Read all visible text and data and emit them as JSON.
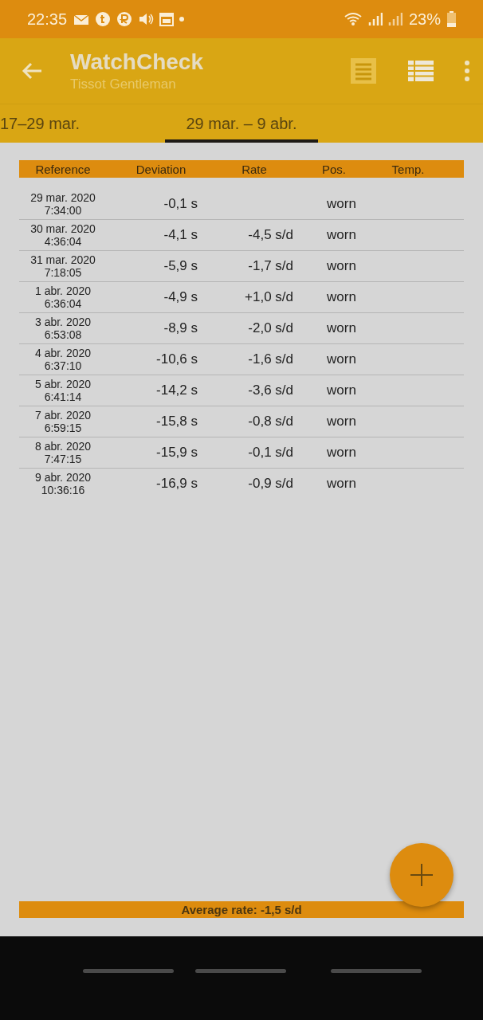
{
  "status_bar": {
    "time": "22:35",
    "battery": "23%"
  },
  "app_bar": {
    "title": "WatchCheck",
    "subtitle": "Tissot Gentleman",
    "view_buttons": [
      {
        "kind": "list",
        "active": false
      },
      {
        "kind": "table",
        "active": true
      }
    ]
  },
  "tabs": [
    {
      "label": "17–29 mar.",
      "selected": false
    },
    {
      "label": "29 mar. – 9 abr.",
      "selected": true
    }
  ],
  "table": {
    "columns": [
      "Reference",
      "Deviation",
      "Rate",
      "Pos.",
      "Temp."
    ],
    "rows": [
      {
        "date": "29 mar. 2020",
        "time": "7:34:00",
        "deviation": "-0,1 s",
        "position": "worn"
      },
      {
        "date": "30 mar. 2020",
        "time": "4:36:04",
        "deviation": "-4,1 s",
        "rate": "-4,5 s/d",
        "position": "worn"
      },
      {
        "date": "31 mar. 2020",
        "time": "7:18:05",
        "deviation": "-5,9 s",
        "rate": "-1,7 s/d",
        "position": "worn"
      },
      {
        "date": "1 abr. 2020",
        "time": "6:36:04",
        "deviation": "-4,9 s",
        "rate": "+1,0 s/d",
        "position": "worn"
      },
      {
        "date": "3 abr. 2020",
        "time": "6:53:08",
        "deviation": "-8,9 s",
        "rate": "-2,0 s/d",
        "position": "worn"
      },
      {
        "date": "4 abr. 2020",
        "time": "6:37:10",
        "deviation": "-10,6 s",
        "rate": "-1,6 s/d",
        "position": "worn"
      },
      {
        "date": "5 abr. 2020",
        "time": "6:41:14",
        "deviation": "-14,2 s",
        "rate": "-3,6 s/d",
        "position": "worn"
      },
      {
        "date": "7 abr. 2020",
        "time": "6:59:15",
        "deviation": "-15,8 s",
        "rate": "-0,8 s/d",
        "position": "worn"
      },
      {
        "date": "8 abr. 2020",
        "time": "7:47:15",
        "deviation": "-15,9 s",
        "rate": "-0,1 s/d",
        "position": "worn"
      },
      {
        "date": "9 abr. 2020",
        "time": "10:36:16",
        "deviation": "-16,9 s",
        "rate": "-0,9 s/d",
        "position": "worn"
      }
    ]
  },
  "summary": "Average rate: -1,5 s/d"
}
